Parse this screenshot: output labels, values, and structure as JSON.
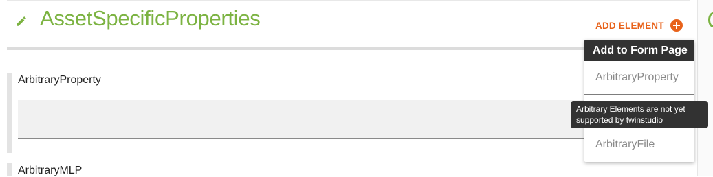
{
  "section": {
    "title": "AssetSpecificProperties",
    "add_element_label": "ADD ELEMENT"
  },
  "properties": [
    {
      "label": "ArbitraryProperty"
    },
    {
      "label": "ArbitraryMLP"
    }
  ],
  "dropdown": {
    "header": "Add to Form Page",
    "items": [
      {
        "label": "ArbitraryProperty"
      },
      {
        "label": "ArbitraryFile"
      }
    ]
  },
  "tooltip": {
    "text": "Arbitrary Elements are not yet supported by twinstudio"
  },
  "colors": {
    "title": "#7cb342",
    "accent": "#e8621a",
    "dropdown_header_bg": "#323232"
  }
}
